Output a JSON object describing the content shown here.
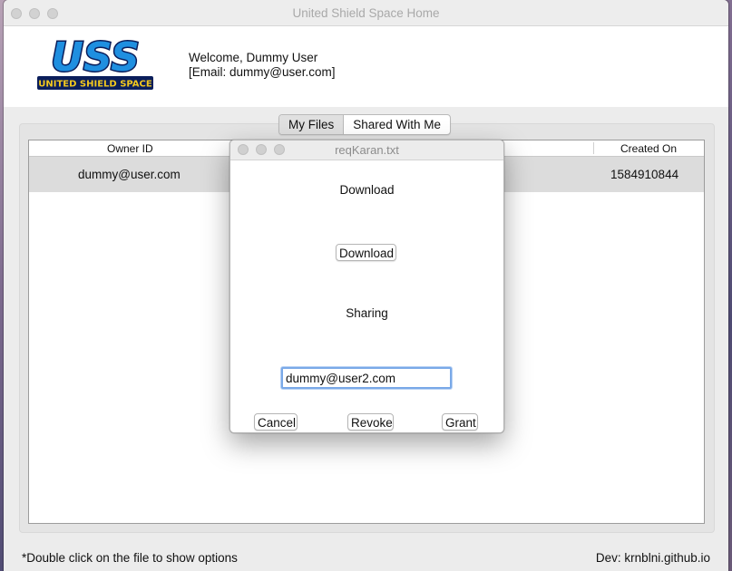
{
  "window": {
    "title": "United Shield Space Home"
  },
  "header": {
    "logo_text": "USS",
    "logo_subtext": "UNITED SHIELD SPACE",
    "welcome_line": "Welcome, Dummy User",
    "email_line": "[Email: dummy@user.com]"
  },
  "tabs": [
    {
      "label": "My Files",
      "selected": true
    },
    {
      "label": "Shared With Me",
      "selected": false
    }
  ],
  "table": {
    "columns": [
      "Owner ID",
      "Created On"
    ],
    "rows": [
      {
        "owner_id": "dummy@user.com",
        "created_on": "1584910844"
      }
    ]
  },
  "footer": {
    "hint": "*Double click on the file to show options",
    "dev": "Dev: krnblni.github.io"
  },
  "dialog": {
    "title": "reqKaran.txt",
    "download_section_label": "Download",
    "download_button": "Download",
    "sharing_section_label": "Sharing",
    "email_value": "dummy@user2.com",
    "cancel_button": "Cancel",
    "revoke_button": "Revoke",
    "grant_button": "Grant"
  },
  "colors": {
    "logo_fill": "#1f8fe0",
    "logo_outline": "#0b1e5b",
    "logo_subtext": "#f2c81e",
    "focus_ring": "#7aa9e8"
  },
  "icons": [
    "close-traffic-light-icon",
    "minimize-traffic-light-icon",
    "zoom-traffic-light-icon"
  ]
}
